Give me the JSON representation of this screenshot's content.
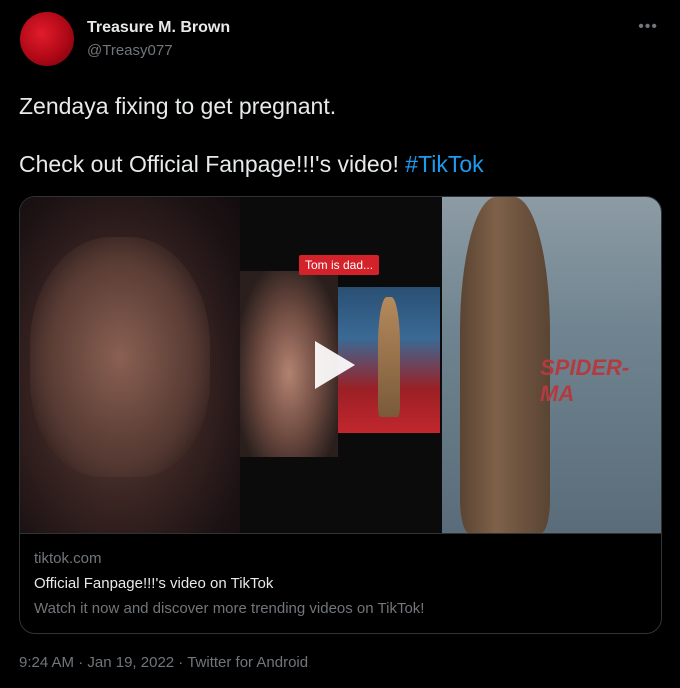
{
  "author": {
    "name": "Treasure M. Brown",
    "handle": "@Treasy077",
    "avatar_color": "#c8101f"
  },
  "tweet": {
    "line1": "Zendaya fixing to get pregnant.",
    "line2_text": "Check out Official Fanpage!!!'s video!",
    "hashtag": "#TikTok"
  },
  "card": {
    "overlay_badge": "Tom is dad...",
    "domain": "tiktok.com",
    "title": "Official Fanpage!!!'s video on TikTok",
    "description": "Watch it now and discover more trending videos on TikTok!",
    "poster_text": "SPIDER-MA"
  },
  "meta": {
    "time": "9:24 AM",
    "sep1": " · ",
    "date": "Jan 19, 2022",
    "sep2": " · ",
    "source": "Twitter for Android"
  },
  "more_icon": "more-horizontal-icon",
  "colors": {
    "background": "#000000",
    "text": "#e7e9ea",
    "secondary": "#71767b",
    "link": "#1d9bf0",
    "border": "#2f3336",
    "badge": "#d4222b"
  }
}
